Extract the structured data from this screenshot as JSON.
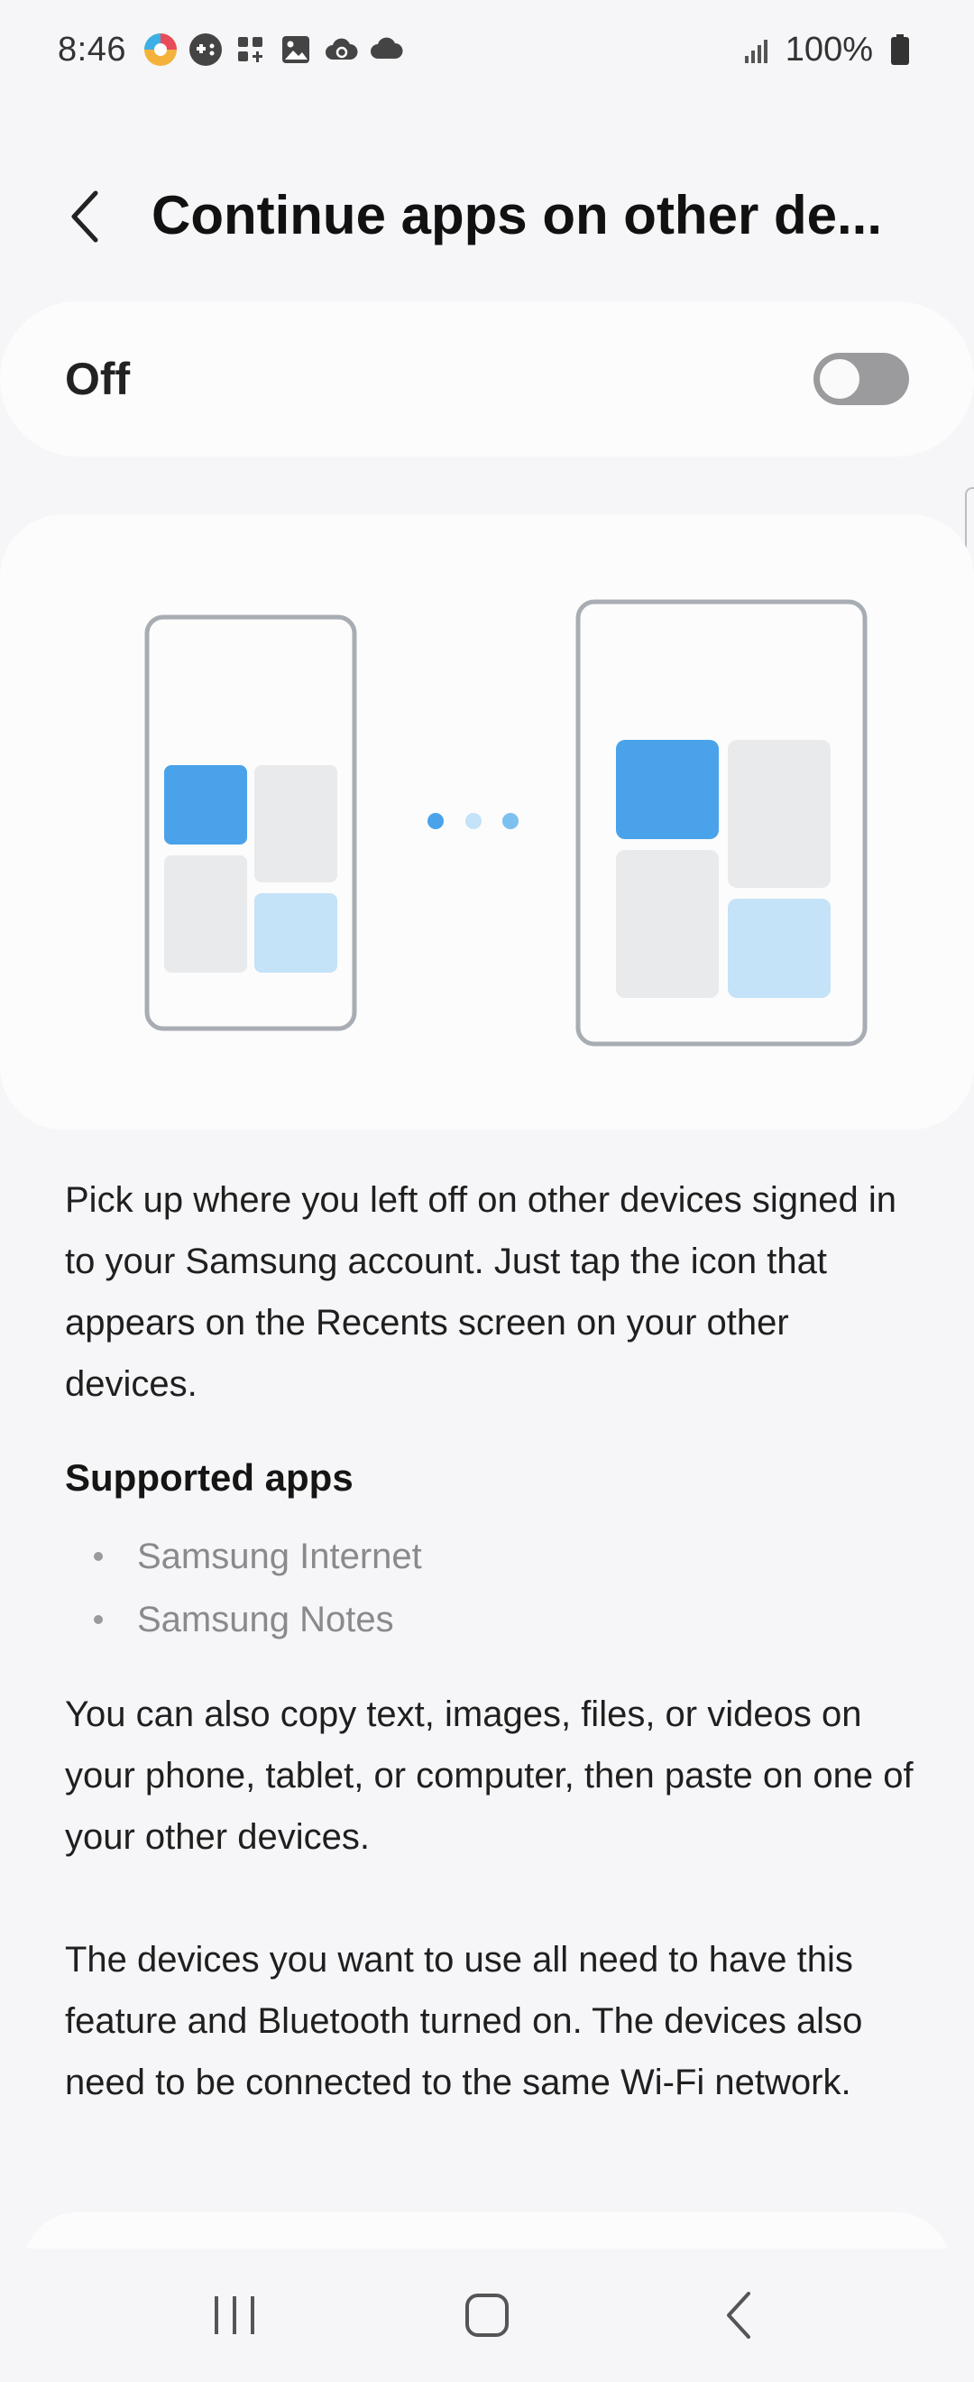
{
  "status_bar": {
    "time": "8:46",
    "battery": "100%",
    "icons": [
      "color-app-icon",
      "game-controller-icon",
      "apps-plus-icon",
      "image-icon",
      "cloud-sync-icon",
      "cloud-icon"
    ]
  },
  "header": {
    "title": "Continue apps on other de..."
  },
  "toggle": {
    "label": "Off",
    "state": "off"
  },
  "description": {
    "paragraph1": "Pick up where you left off on other devices signed in to your Samsung account. Just tap the icon that appears on the Recents screen on your other devices.",
    "supported_heading": "Supported apps",
    "supported_apps": [
      "Samsung Internet",
      "Samsung Notes"
    ],
    "paragraph2": "You can also copy text, images, files, or videos on your phone, tablet, or computer, then paste on one of your other devices.",
    "paragraph3": "The devices you want to use all need to have this feature and Bluetooth turned on. The devices also need to be connected to the same Wi-Fi network."
  },
  "colors": {
    "accent_blue": "#4aa3ea",
    "light_blue": "#c4e2f8",
    "tile_gray": "#e8eaeb",
    "frame_gray": "#a7adb2",
    "switch_off": "#9b9b9e"
  },
  "nav": {
    "recents": "recents-icon",
    "home": "home-icon",
    "back": "back-icon"
  }
}
